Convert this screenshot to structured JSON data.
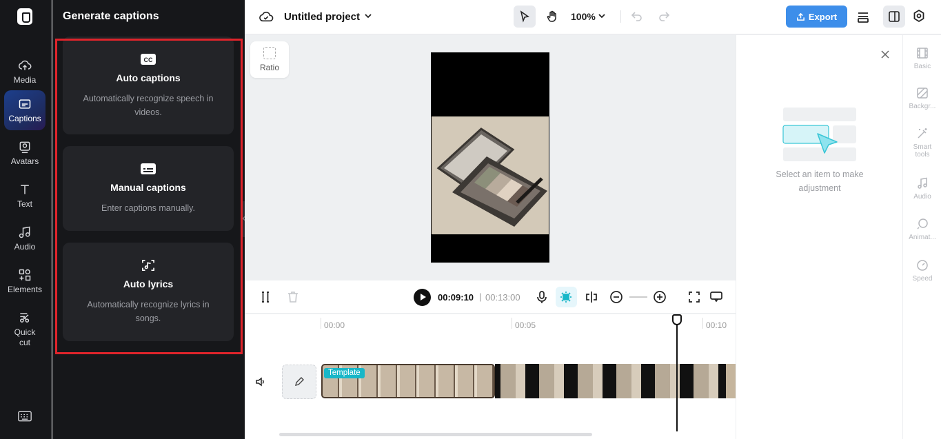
{
  "rail": {
    "items": [
      {
        "label": "Media",
        "icon": "cloud-upload-icon"
      },
      {
        "label": "Captions",
        "icon": "captions-icon",
        "active": true
      },
      {
        "label": "Avatars",
        "icon": "avatar-icon"
      },
      {
        "label": "Text",
        "icon": "text-icon"
      },
      {
        "label": "Audio",
        "icon": "music-note-icon"
      },
      {
        "label": "Elements",
        "icon": "elements-icon"
      },
      {
        "label": "Quick cut",
        "icon": "quick-cut-icon"
      }
    ]
  },
  "panel": {
    "title": "Generate captions",
    "cards": [
      {
        "title": "Auto captions",
        "desc": "Automatically recognize speech in videos.",
        "icon": "cc-icon"
      },
      {
        "title": "Manual captions",
        "desc": "Enter captions manually.",
        "icon": "keyboard-caption-icon"
      },
      {
        "title": "Auto lyrics",
        "desc": "Automatically recognize lyrics in songs.",
        "icon": "lyrics-icon"
      }
    ]
  },
  "topbar": {
    "project_name": "Untitled project",
    "zoom": "100%",
    "export_label": "Export"
  },
  "canvas": {
    "ratio_label": "Ratio"
  },
  "right_panel": {
    "empty_text": "Select an item to make adjustment",
    "props": [
      {
        "label": "Basic",
        "icon": "film-icon"
      },
      {
        "label": "Backgr...",
        "icon": "background-icon"
      },
      {
        "label": "Smart tools",
        "icon": "magic-wand-icon"
      },
      {
        "label": "Audio",
        "icon": "music-note-icon"
      },
      {
        "label": "Animat...",
        "icon": "animation-icon"
      },
      {
        "label": "Speed",
        "icon": "speed-icon"
      }
    ]
  },
  "timeline": {
    "current_time": "00:09:10",
    "separator": "|",
    "total_time": "00:13:00",
    "ticks": [
      "00:00",
      "00:05",
      "00:10"
    ],
    "clip_tag": "Template"
  },
  "colors": {
    "accent": "#3d8eea",
    "highlight": "#e0242b",
    "template_tag": "#18b7c8"
  }
}
